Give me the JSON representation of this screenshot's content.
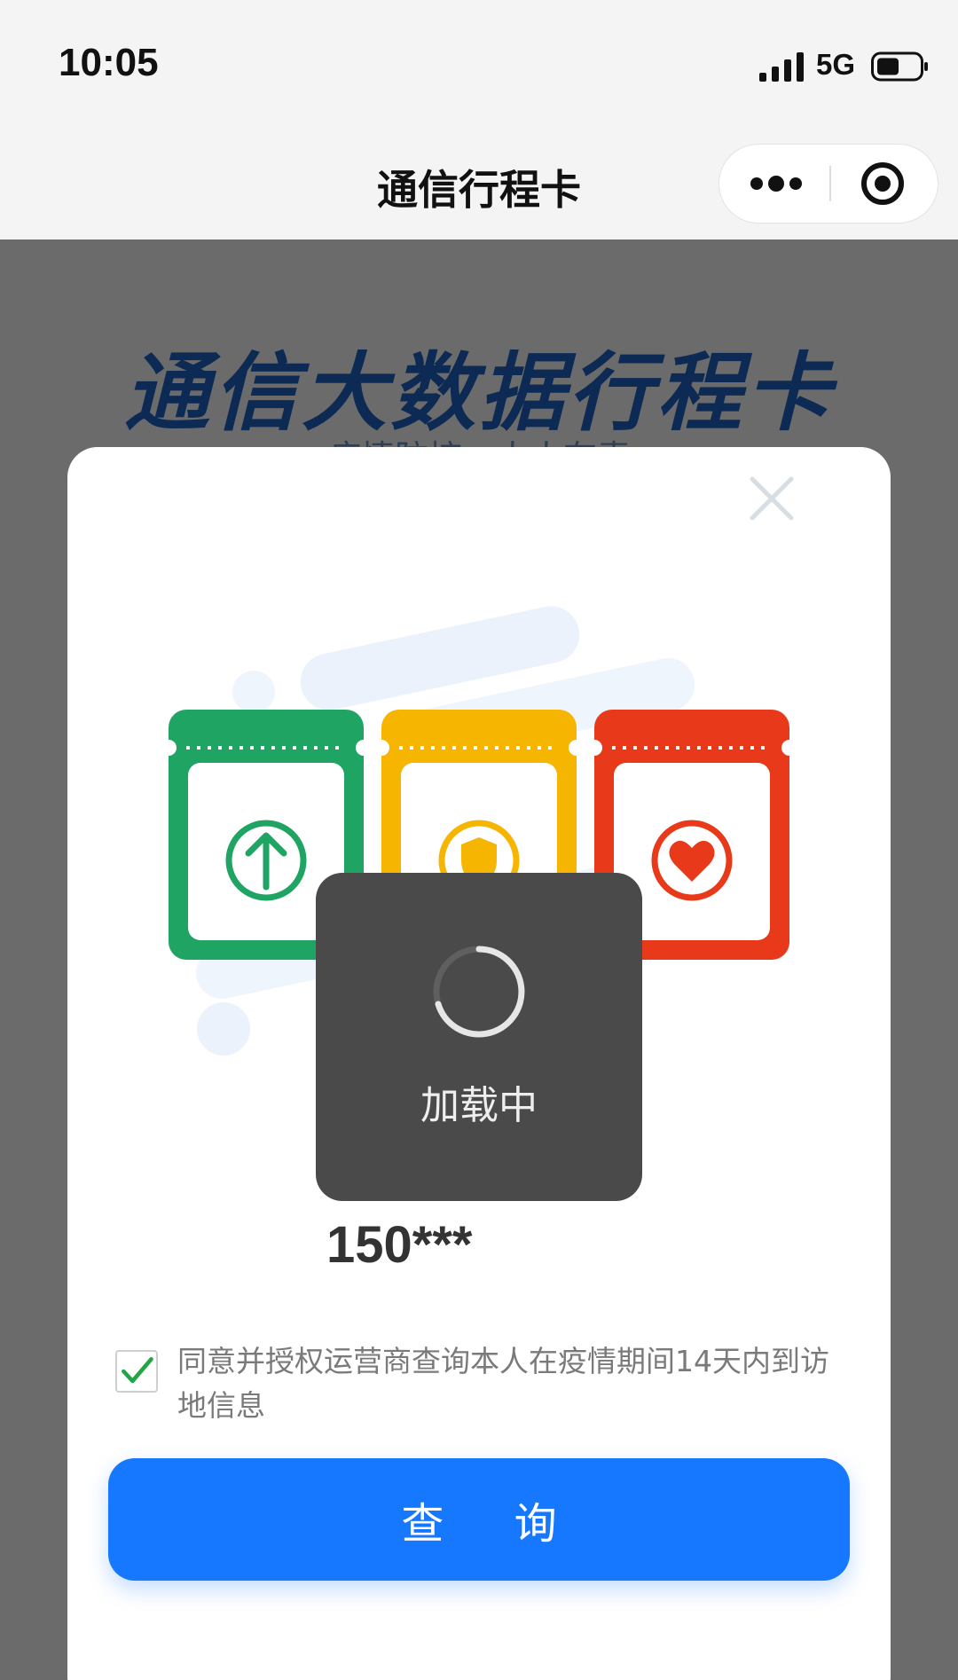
{
  "status_bar": {
    "time": "10:05",
    "network": "5G",
    "icons": [
      "signal-icon",
      "battery-icon"
    ]
  },
  "nav": {
    "title": "通信行程卡",
    "icons": [
      "more-dots-icon",
      "close-miniprogram-icon"
    ]
  },
  "page": {
    "hero_title": "通信大数据行程卡",
    "hero_subtitle": "疫情防控，人人有责"
  },
  "modal": {
    "close_icon": "close-icon",
    "illustration": {
      "cards": [
        {
          "color": "#1fa463",
          "icon": "arrow-up-icon"
        },
        {
          "color": "#f6b500",
          "icon": "shield-icon"
        },
        {
          "color": "#e8391b",
          "icon": "heart-icon"
        }
      ]
    },
    "phone_masked": "150***",
    "consent": {
      "checked": true,
      "text": "同意并授权运营商查询本人在疫情期间14天内到访地信息"
    },
    "query_button": "查 询"
  },
  "loading": {
    "label": "加载中",
    "icon": "spinner-icon"
  },
  "colors": {
    "primary": "#1677ff",
    "overlay": "#6b6b6b",
    "toast": "#4a4a4a",
    "hero_title": "#0d2a55"
  }
}
